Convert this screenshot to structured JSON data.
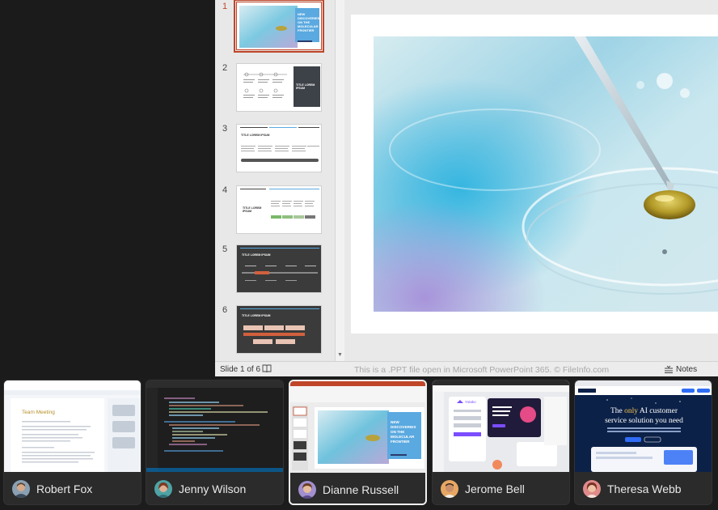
{
  "ppt": {
    "thumbnails": [
      {
        "number": "1",
        "title": "NEW DISCOVERIES ON THE MOLECULAR FRONTIER"
      },
      {
        "number": "2",
        "title": "TITLE LOREM IPSUM"
      },
      {
        "number": "3",
        "title": "TITLE LOREM IPSUM"
      },
      {
        "number": "4",
        "title": "TITLE LOREM IPSUM"
      },
      {
        "number": "5",
        "title": "TITLE LOREM IPSUM"
      },
      {
        "number": "6",
        "title": "TITLE LOREM IPSUM"
      }
    ],
    "status": {
      "slide_counter": "Slide 1 of 6",
      "note": "This is a .PPT file open in Microsoft PowerPoint 365. © FileInfo.com",
      "notes_label": "Notes"
    }
  },
  "switcher": {
    "cards": [
      {
        "name": "Robert Fox",
        "selected": false,
        "doc_title": "Team Meeting"
      },
      {
        "name": "Jenny Wilson",
        "selected": false
      },
      {
        "name": "Dianne Russell",
        "selected": true,
        "doc_title": "NEW DISCOVERIES ON THE MOLECULAR FRONTIER"
      },
      {
        "name": "Jerome Bell",
        "selected": false,
        "doc_title": "Yotako"
      },
      {
        "name": "Theresa Webb",
        "selected": false,
        "doc_title": "The only AI customer service solution you need"
      }
    ]
  },
  "colors": {
    "accent": "#c0462a",
    "selected_border": "#f1f1f1",
    "slide_blue": "#5aa9e0"
  }
}
